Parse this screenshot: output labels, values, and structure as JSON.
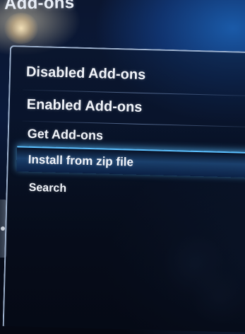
{
  "window": {
    "title": "Add-ons"
  },
  "menu": {
    "items": [
      {
        "label": "Disabled Add-ons",
        "selected": false
      },
      {
        "label": "Enabled Add-ons",
        "selected": false
      },
      {
        "label": "Get Add-ons",
        "selected": false
      },
      {
        "label": "Install from zip file",
        "selected": true
      },
      {
        "label": "Search",
        "selected": false
      }
    ]
  },
  "colors": {
    "background": "#0a1a3c",
    "text": "#f1f4fa",
    "highlight": "#5cc0ff",
    "panel_border": "#9fb3cf"
  }
}
